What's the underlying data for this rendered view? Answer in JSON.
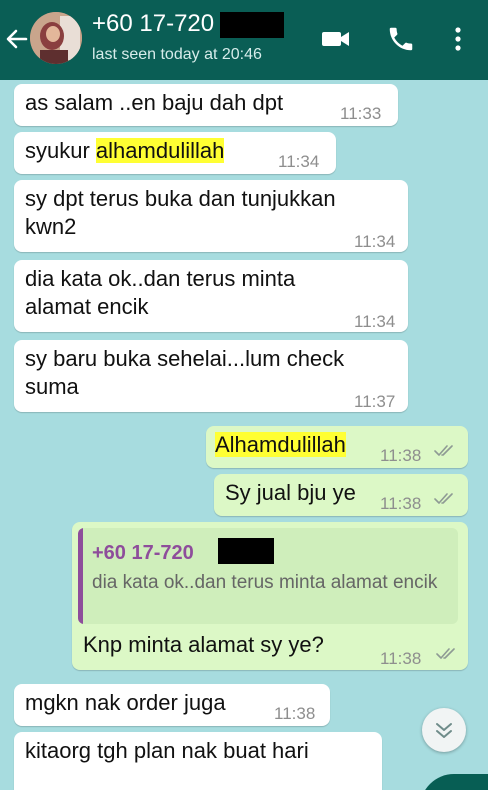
{
  "header": {
    "contact_name": "+60 17-720",
    "last_seen": "last seen today at 20:46",
    "icons": [
      "back-arrow-icon",
      "video-call-icon",
      "phone-icon",
      "more-vert-icon"
    ],
    "background_color": "#0a5e55"
  },
  "messages": [
    {
      "direction": "in",
      "text": "as salam ..en baju dah dpt",
      "time": "11:33"
    },
    {
      "direction": "in",
      "text_before": "syukur ",
      "text_highlight": "alhamdulillah",
      "time": "11:34"
    },
    {
      "direction": "in",
      "line1": "sy dpt terus buka dan tunjukkan",
      "line2": "kwn2",
      "time": "11:34"
    },
    {
      "direction": "in",
      "line1": "dia kata ok..dan terus minta",
      "line2": "alamat encik",
      "time": "11:34"
    },
    {
      "direction": "in",
      "line1": "sy baru buka sehelai...lum check",
      "line2": "suma",
      "time": "11:37"
    },
    {
      "direction": "out",
      "text_highlight": "Alhamdulillah",
      "time": "11:38",
      "status": "read"
    },
    {
      "direction": "out",
      "text": "Sy jual bju ye",
      "time": "11:38",
      "status": "read"
    },
    {
      "direction": "out",
      "quote_name": "+60 17-720",
      "quote_text": "dia kata ok..dan terus minta alamat encik",
      "text": "Knp minta alamat sy ye?",
      "time": "11:38",
      "status": "read"
    },
    {
      "direction": "in",
      "text": "mgkn nak order juga",
      "time": "11:38"
    },
    {
      "direction": "in",
      "text": "kitaorg tgh plan nak buat hari"
    }
  ],
  "colors": {
    "chat_background": "#a7dcdf",
    "incoming_bubble": "#ffffff",
    "outgoing_bubble": "#dcf8c6",
    "highlight": "#ffff33",
    "quote_accent": "#8e4d9b"
  }
}
